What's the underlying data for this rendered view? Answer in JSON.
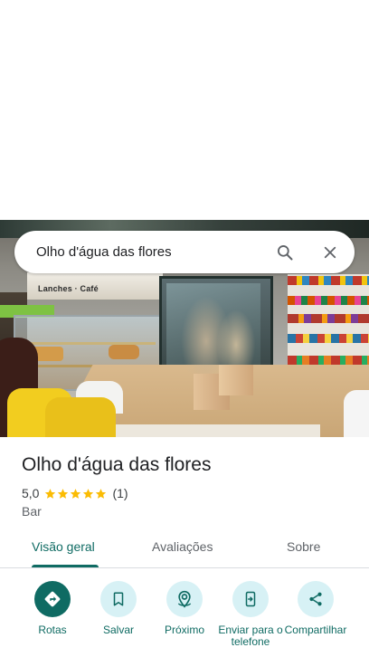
{
  "search": {
    "query": "Olho d'água das flores"
  },
  "photo": {
    "sign_text": "Lanches · Café"
  },
  "place": {
    "name": "Olho d'água das flores",
    "rating": "5,0",
    "stars": 5,
    "review_count": "(1)",
    "category": "Bar"
  },
  "tabs": [
    {
      "label": "Visão geral",
      "active": true
    },
    {
      "label": "Avaliações",
      "active": false
    },
    {
      "label": "Sobre",
      "active": false
    }
  ],
  "actions": [
    {
      "label": "Rotas",
      "icon": "directions-icon"
    },
    {
      "label": "Salvar",
      "icon": "bookmark-icon"
    },
    {
      "label": "Próximo",
      "icon": "nearby-icon"
    },
    {
      "label": "Enviar para o telefone",
      "icon": "send-to-phone-icon"
    },
    {
      "label": "Compartilhar",
      "icon": "share-icon"
    }
  ],
  "colors": {
    "accent": "#0f6b63",
    "accent_light": "#d7f1f5",
    "star": "#fbbc04"
  }
}
